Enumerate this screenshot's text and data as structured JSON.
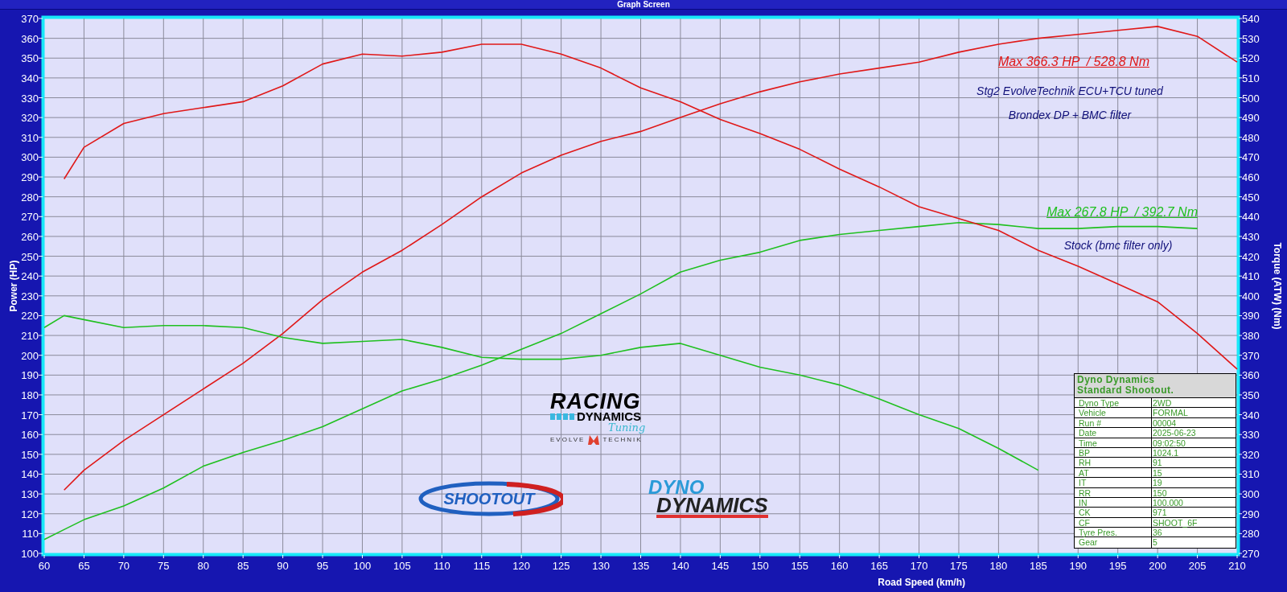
{
  "window": {
    "title": "Graph Screen"
  },
  "power_graph": {
    "chart_data": {
      "type": "line",
      "xlabel": "Road Speed (km/h)",
      "ylabel": "Power (HP)",
      "x": [
        60,
        62.5,
        65,
        70,
        75,
        80,
        85,
        90,
        95,
        100,
        105,
        110,
        115,
        120,
        125,
        130,
        135,
        140,
        145,
        150,
        155,
        160,
        165,
        170,
        175,
        180,
        185,
        190,
        195,
        200,
        205,
        210
      ],
      "series": [
        {
          "color": "#e01818",
          "values": [
            null,
            132,
            142,
            157,
            170,
            183,
            196,
            211,
            228,
            242,
            253,
            266,
            280,
            292,
            301,
            308,
            313,
            320,
            327,
            333,
            338,
            342,
            345,
            348,
            353,
            357,
            360,
            362,
            364,
            366,
            361,
            348
          ]
        },
        {
          "color": "#20c020",
          "values": [
            107,
            112,
            117,
            124,
            133,
            144,
            151,
            157,
            164,
            173,
            182,
            188,
            195,
            203,
            211,
            221,
            231,
            242,
            248,
            252,
            258,
            261,
            263,
            265,
            267,
            266,
            264,
            264,
            265,
            265,
            264,
            null
          ]
        }
      ],
      "grid": true,
      "xlim": [
        60,
        210
      ],
      "ylim": [
        100,
        370
      ],
      "xticks": [
        60,
        65,
        70,
        75,
        80,
        85,
        90,
        95,
        100,
        105,
        110,
        115,
        120,
        125,
        130,
        135,
        140,
        145,
        150,
        155,
        160,
        165,
        170,
        175,
        180,
        185,
        190,
        195,
        200,
        205,
        210
      ],
      "yticks": [
        100,
        110,
        120,
        130,
        140,
        150,
        160,
        170,
        180,
        190,
        200,
        210,
        220,
        230,
        240,
        250,
        260,
        270,
        280,
        290,
        300,
        310,
        320,
        330,
        340,
        350,
        360,
        370
      ]
    }
  },
  "torque_graph": {
    "chart_data": {
      "type": "line",
      "ylabel": "Torque (ATW) (Nm)",
      "x": [
        60,
        62.5,
        65,
        70,
        75,
        80,
        85,
        90,
        95,
        100,
        105,
        110,
        115,
        120,
        125,
        130,
        135,
        140,
        145,
        150,
        155,
        160,
        165,
        170,
        175,
        180,
        185,
        190,
        195,
        200,
        205,
        210
      ],
      "series": [
        {
          "color": "#e01818",
          "values": [
            null,
            459,
            475,
            487,
            492,
            495,
            498,
            506,
            517,
            522,
            521,
            523,
            527,
            527,
            522,
            515,
            505,
            498,
            489,
            482,
            474,
            464,
            455,
            445,
            439,
            433,
            423,
            415,
            406,
            397,
            381,
            363
          ]
        },
        {
          "color": "#20c020",
          "values": [
            384,
            390,
            388,
            384,
            385,
            385,
            384,
            379,
            376,
            377,
            378,
            374,
            369,
            368,
            368,
            370,
            374,
            376,
            370,
            364,
            360,
            355,
            348,
            340,
            333,
            323,
            312,
            null,
            null,
            null,
            null,
            null
          ]
        }
      ],
      "xlim": [
        60,
        210
      ],
      "ylim": [
        270,
        540
      ],
      "yticks": [
        270,
        280,
        290,
        300,
        310,
        320,
        330,
        340,
        350,
        360,
        370,
        380,
        390,
        400,
        410,
        420,
        430,
        440,
        450,
        460,
        470,
        480,
        490,
        500,
        510,
        520,
        530,
        540
      ]
    }
  },
  "notes": [
    {
      "kind": "peak",
      "text": "Max 366.3 HP  / 528.8 Nm",
      "color": "#e01818"
    },
    {
      "kind": "caption",
      "text": "Stg2 EvolveTechnik ECU+TCU tuned"
    },
    {
      "kind": "caption",
      "text": "Brondex DP + BMC filter"
    },
    {
      "kind": "peak",
      "text": "Max 267.8 HP  / 392.7 Nm",
      "color": "#20c020"
    },
    {
      "kind": "caption",
      "text": "Stock (bmc filter only)"
    }
  ],
  "logos": {
    "racing_dynamics": {
      "line_1": "RACING",
      "line_2": "DYNAMICS",
      "script": "Tuning"
    },
    "evolve": [
      "EVOLVE",
      "TECHNIK"
    ],
    "shootout": "SHOOTOUT",
    "dyno_dynamics": [
      "DYNO",
      "DYNAMICS"
    ]
  },
  "info_table": {
    "title": [
      "Dyno Dynamics",
      "Standard Shootout."
    ],
    "rows": [
      {
        "label": "Dyno Type",
        "value": "2WD"
      },
      {
        "label": "Vehicle",
        "value": "FORMAL"
      },
      {
        "label": "Run #",
        "value": "00004"
      },
      {
        "label": "Date",
        "value": "2025-06-23"
      },
      {
        "label": "Time",
        "value": "09:02:50"
      },
      {
        "label": "BP",
        "value": "1024.1"
      },
      {
        "label": "RH",
        "value": "91"
      },
      {
        "label": "AT",
        "value": "15"
      },
      {
        "label": "IT",
        "value": "19"
      },
      {
        "label": "RR",
        "value": "150"
      },
      {
        "label": "IN",
        "value": "100.000"
      },
      {
        "label": "CK",
        "value": "971"
      },
      {
        "label": "CF",
        "value": "SHOOT_6F"
      },
      {
        "label": "Tyre Pres.",
        "value": "36"
      },
      {
        "label": "Gear",
        "value": "5"
      }
    ]
  }
}
